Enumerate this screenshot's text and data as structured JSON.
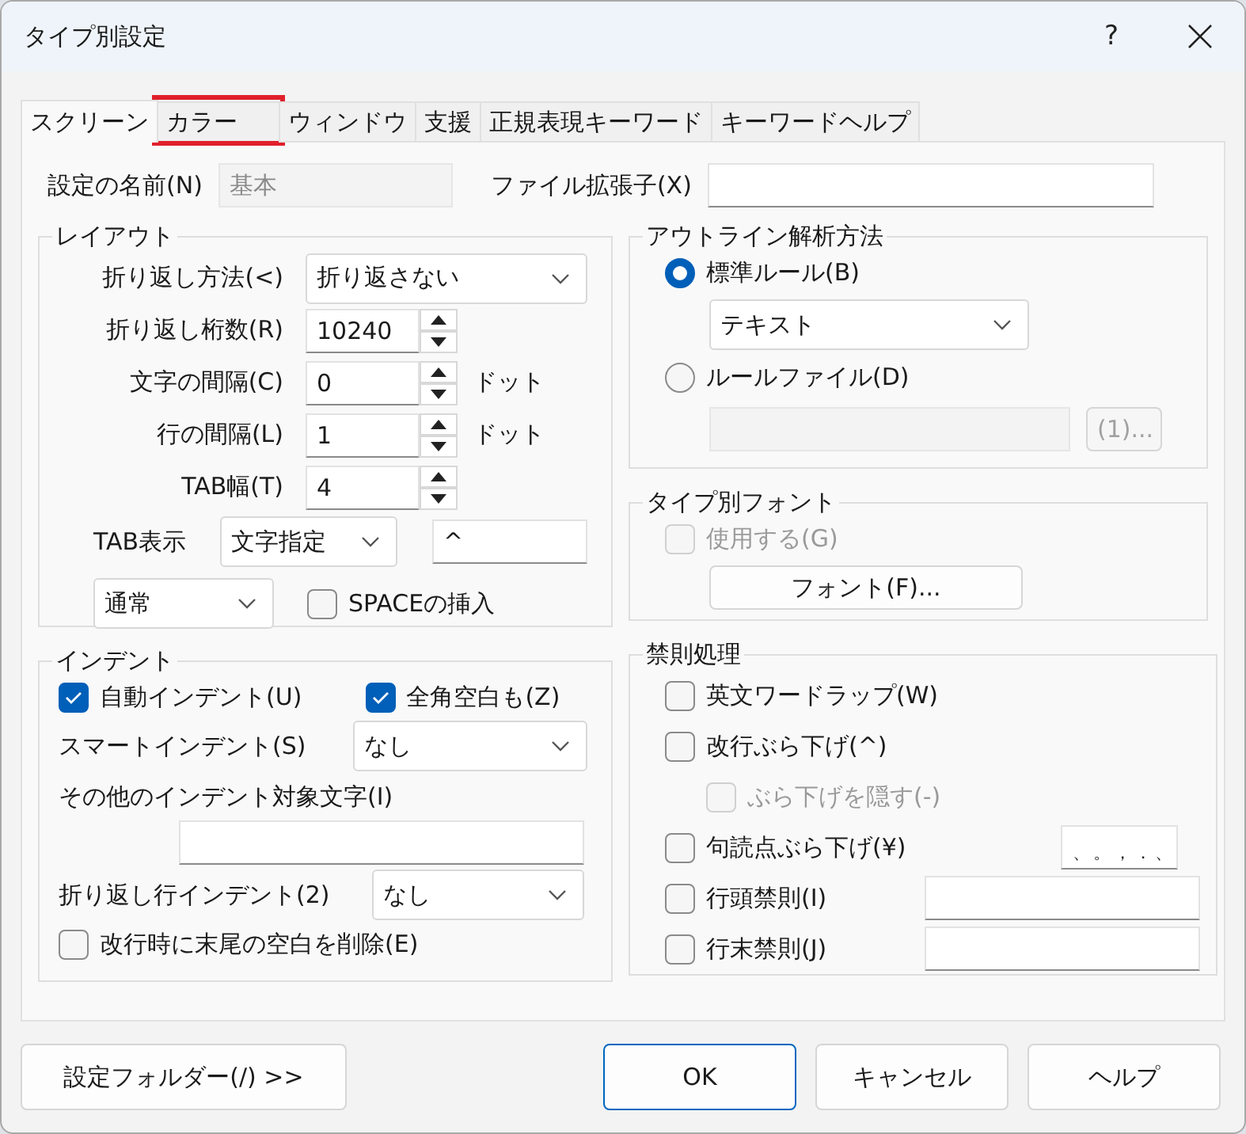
{
  "window": {
    "title": "タイプ別設定",
    "help": "?"
  },
  "tabs": [
    {
      "label": "スクリーン",
      "selected": true,
      "highlighted": false
    },
    {
      "label": "カラー",
      "selected": false,
      "highlighted": true
    },
    {
      "label": "ウィンドウ",
      "selected": false,
      "highlighted": false
    },
    {
      "label": "支援",
      "selected": false,
      "highlighted": false
    },
    {
      "label": "正規表現キーワード",
      "selected": false,
      "highlighted": false
    },
    {
      "label": "キーワードヘルプ",
      "selected": false,
      "highlighted": false
    }
  ],
  "name_field": {
    "label": "設定の名前(N)",
    "value": "基本",
    "disabled": true
  },
  "extension_field": {
    "label": "ファイル拡張子(X)",
    "disabled": false
  },
  "layout": {
    "title": "レイアウト",
    "rows": [
      {
        "kind": "select",
        "label": "折り返し方法(<)",
        "value": "折り返さない"
      },
      {
        "kind": "spinner",
        "label": "折り返し桁数(R)",
        "value": "10240"
      },
      {
        "kind": "spinner",
        "label": "文字の間隔(C)",
        "value": "0",
        "unit": "ドット"
      },
      {
        "kind": "spinner",
        "label": "行の間隔(L)",
        "value": "1",
        "unit": "ドット"
      },
      {
        "kind": "spinner",
        "label": "TAB幅(T)",
        "value": "4"
      }
    ],
    "tab_display": {
      "label": "TAB表示",
      "mode": "文字指定",
      "char": "^"
    },
    "space_mode": "通常",
    "space_insert": {
      "label": "SPACEの挿入",
      "checked": false
    }
  },
  "indent": {
    "title": "インデント",
    "auto": {
      "label": "自動インデント(U)",
      "checked": true
    },
    "fullwidth": {
      "label": "全角空白も(Z)",
      "checked": true
    },
    "smart": {
      "label": "スマートインデント(S)",
      "value": "なし"
    },
    "other_label": "その他のインデント対象文字(I)",
    "wrap": {
      "label": "折り返し行インデント(2)",
      "value": "なし"
    },
    "trim": {
      "label": "改行時に末尾の空白を削除(E)",
      "checked": false
    }
  },
  "outline": {
    "title": "アウトライン解析方法",
    "options": [
      {
        "label": "標準ルール(B)",
        "selected": true
      },
      {
        "label": "ルールファイル(D)",
        "selected": false
      }
    ],
    "rule": "テキスト",
    "file_button": {
      "label": "(1)...",
      "disabled": true
    }
  },
  "font": {
    "title": "タイプ別フォント",
    "use": {
      "label": "使用する(G)",
      "checked": false,
      "disabled": true
    },
    "button": "フォント(F)..."
  },
  "kinsoku": {
    "title": "禁則処理",
    "rows": [
      {
        "kind": "check",
        "label": "英文ワードラップ(W)",
        "checked": false,
        "disabled": false
      },
      {
        "kind": "check",
        "label": "改行ぶら下げ(^)",
        "checked": false,
        "disabled": false,
        "children": [
          {
            "kind": "check",
            "label": "ぶら下げを隠す(-)",
            "checked": false,
            "disabled": true
          }
        ]
      },
      {
        "kind": "punct",
        "label": "句読点ぶら下げ(¥)",
        "checked": false,
        "disabled": false,
        "field": "、。，．、"
      },
      {
        "kind": "chars",
        "label": "行頭禁則(I)",
        "checked": false,
        "disabled": false
      },
      {
        "kind": "chars",
        "label": "行末禁則(J)",
        "checked": false,
        "disabled": false
      }
    ]
  },
  "buttons": [
    {
      "label": "設定フォルダー(/) >>",
      "default": false
    },
    {
      "label": "OK",
      "default": true
    },
    {
      "label": "キャンセル",
      "default": false
    },
    {
      "label": "ヘルプ",
      "default": false
    }
  ]
}
